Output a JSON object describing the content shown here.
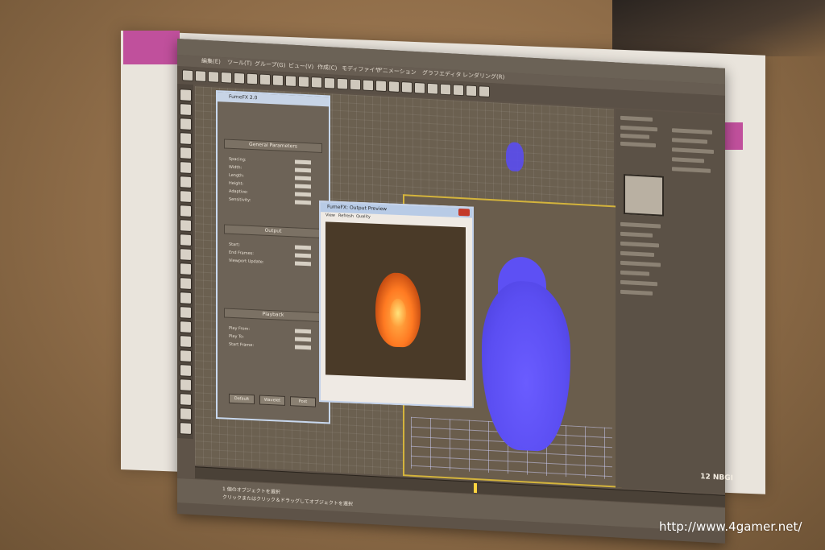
{
  "photo": {
    "subject": "",
    "watermark": "http://www.4gamer.net/"
  },
  "app": {
    "menu": [
      "編集(E)",
      "ツール(T)",
      "グループ(G)",
      "ビュー(V)",
      "作成(C)",
      "モディファイヤ",
      "アニメーション",
      "グラフエディタ",
      "レンダリング(R)"
    ],
    "brand_suffix": "12 NBGI",
    "timeline_marker": "",
    "status_lines": [
      "1 個のオブジェクトを選択",
      "クリックまたはクリック＆ドラッグしてオブジェクトを選択"
    ]
  },
  "fumefx_window": {
    "title": "FumeFX 2.0",
    "sections": [
      "General Parameters",
      "Output",
      "Playback"
    ],
    "fields": [
      "Spacing:",
      "Width:",
      "Length:",
      "Height:",
      "Adaptive:",
      "Sensitivity:",
      "Start:",
      "End Frames:",
      "Viewport Update:",
      "Play From:",
      "Play To:",
      "Start Frame:"
    ],
    "buttons": [
      "Default",
      "Wavelet",
      "Post"
    ]
  },
  "preview_window": {
    "title": "FumeFX: Output Preview",
    "menu": [
      "View",
      "Refresh",
      "Quality"
    ],
    "frame_label": "",
    "status": ""
  },
  "colors": {
    "accent_pink": "#c0509c",
    "smoke_blue": "#5b4ef2",
    "flame_orange": "#ff7a22",
    "viewport_border": "#d4b43c"
  }
}
